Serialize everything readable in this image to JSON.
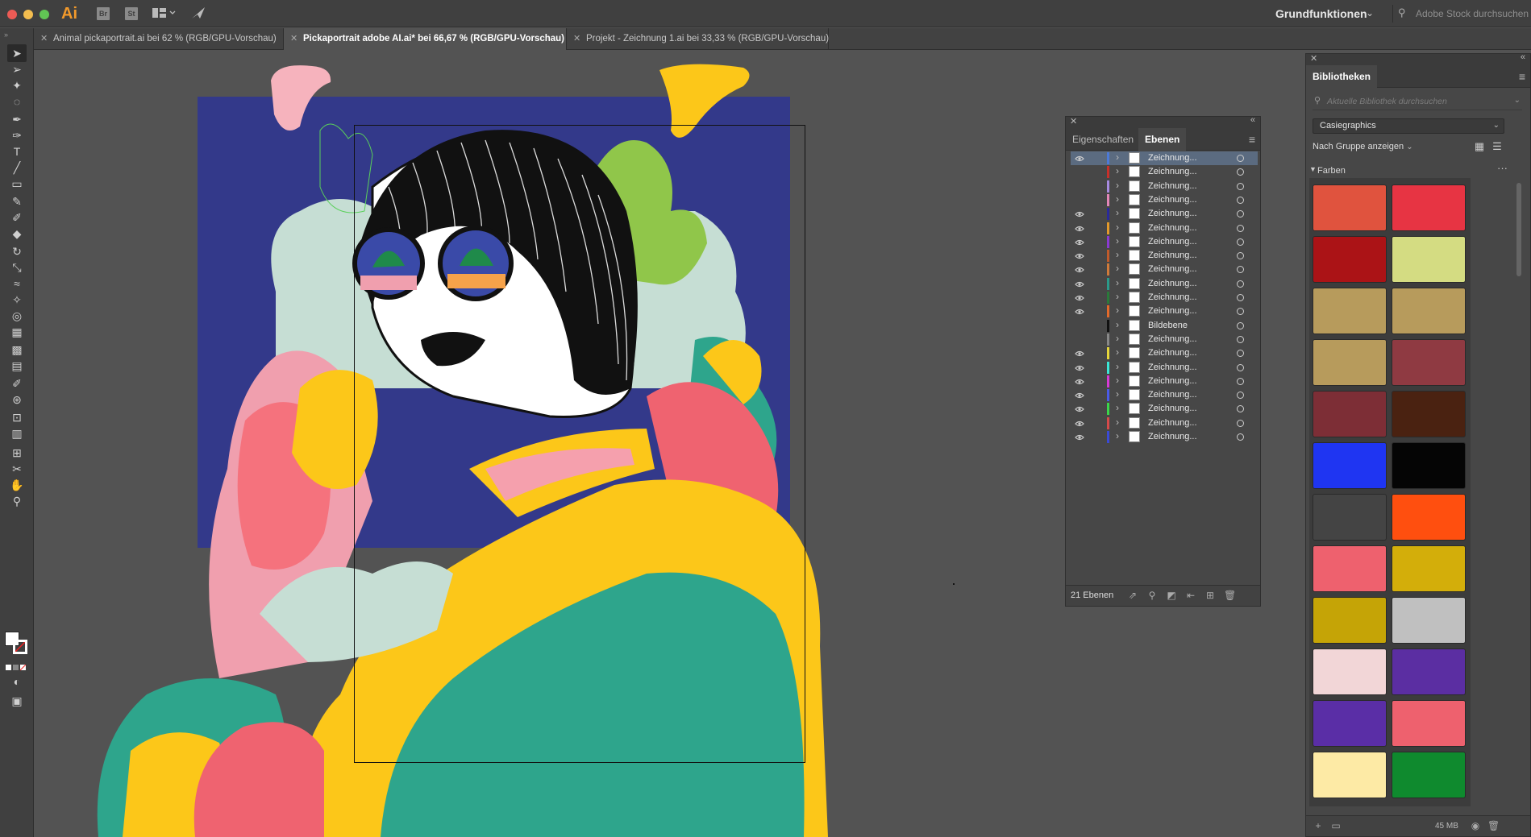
{
  "app": {
    "logo": "Ai",
    "bridge_label": "Br",
    "stock_label": "St",
    "workspace": "Grundfunktionen",
    "stock_search_placeholder": "Adobe Stock durchsuchen"
  },
  "tabs": [
    {
      "label": "Animal pickaportrait.ai bei 62 % (RGB/GPU-Vorschau)",
      "active": false
    },
    {
      "label": "Pickaportrait adobe AI.ai* bei 66,67 % (RGB/GPU-Vorschau)",
      "active": true
    },
    {
      "label": "Projekt - Zeichnung 1.ai bei 33,33 % (RGB/GPU-Vorschau)",
      "active": false
    }
  ],
  "tools": [
    {
      "name": "selection-tool-icon",
      "glyph": "➤"
    },
    {
      "name": "direct-selection-tool-icon",
      "glyph": "➢"
    },
    {
      "name": "magic-wand-tool-icon",
      "glyph": "✦"
    },
    {
      "name": "lasso-tool-icon",
      "glyph": "◌"
    },
    {
      "name": "pen-tool-icon",
      "glyph": "✒"
    },
    {
      "name": "curvature-tool-icon",
      "glyph": "✑"
    },
    {
      "name": "type-tool-icon",
      "glyph": "T"
    },
    {
      "name": "line-tool-icon",
      "glyph": "╱"
    },
    {
      "name": "rectangle-tool-icon",
      "glyph": "▭"
    },
    {
      "name": "paintbrush-tool-icon",
      "glyph": "✎"
    },
    {
      "name": "shaper-tool-icon",
      "glyph": "✐"
    },
    {
      "name": "eraser-tool-icon",
      "glyph": "◆"
    },
    {
      "name": "rotate-tool-icon",
      "glyph": "↻"
    },
    {
      "name": "scale-tool-icon",
      "glyph": "⤡"
    },
    {
      "name": "warp-tool-icon",
      "glyph": "≈"
    },
    {
      "name": "puppet-warp-tool-icon",
      "glyph": "✧"
    },
    {
      "name": "shape-builder-tool-icon",
      "glyph": "◎"
    },
    {
      "name": "perspective-grid-tool-icon",
      "glyph": "▦"
    },
    {
      "name": "mesh-tool-icon",
      "glyph": "▩"
    },
    {
      "name": "gradient-tool-icon",
      "glyph": "▤"
    },
    {
      "name": "eyedropper-tool-icon",
      "glyph": "✐"
    },
    {
      "name": "blend-tool-icon",
      "glyph": "⊛"
    },
    {
      "name": "symbol-sprayer-tool-icon",
      "glyph": "⊡"
    },
    {
      "name": "graph-tool-icon",
      "glyph": "▥"
    },
    {
      "name": "artboard-tool-icon",
      "glyph": "⊞"
    },
    {
      "name": "slice-tool-icon",
      "glyph": "✂"
    },
    {
      "name": "hand-tool-icon",
      "glyph": "✋"
    },
    {
      "name": "zoom-tool-icon",
      "glyph": "⚲"
    }
  ],
  "layers_panel": {
    "tab_properties": "Eigenschaften",
    "tab_layers": "Ebenen",
    "count_label": "21 Ebenen",
    "layers": [
      {
        "name": "Zeichnung...",
        "color": "#4c7ad8",
        "visible": true,
        "selected": true
      },
      {
        "name": "Zeichnung...",
        "color": "#c8302a",
        "visible": false,
        "selected": false
      },
      {
        "name": "Zeichnung...",
        "color": "#a78ae0",
        "visible": false,
        "selected": false
      },
      {
        "name": "Zeichnung...",
        "color": "#e386b8",
        "visible": false,
        "selected": false
      },
      {
        "name": "Zeichnung...",
        "color": "#2a2a9a",
        "visible": true,
        "selected": false
      },
      {
        "name": "Zeichnung...",
        "color": "#e39a2a",
        "visible": true,
        "selected": false
      },
      {
        "name": "Zeichnung...",
        "color": "#8a3ad0",
        "visible": true,
        "selected": false
      },
      {
        "name": "Zeichnung...",
        "color": "#c05a2a",
        "visible": true,
        "selected": false
      },
      {
        "name": "Zeichnung...",
        "color": "#d07a3a",
        "visible": true,
        "selected": false
      },
      {
        "name": "Zeichnung...",
        "color": "#2a9a8a",
        "visible": true,
        "selected": false
      },
      {
        "name": "Zeichnung...",
        "color": "#2a7a3a",
        "visible": true,
        "selected": false
      },
      {
        "name": "Zeichnung...",
        "color": "#e36a2a",
        "visible": true,
        "selected": false
      },
      {
        "name": "Bildebene",
        "color": "#111111",
        "visible": false,
        "selected": false
      },
      {
        "name": "Zeichnung...",
        "color": "#888888",
        "visible": false,
        "selected": false
      },
      {
        "name": "Zeichnung...",
        "color": "#e6d63a",
        "visible": true,
        "selected": false
      },
      {
        "name": "Zeichnung...",
        "color": "#3ae6d6",
        "visible": true,
        "selected": false
      },
      {
        "name": "Zeichnung...",
        "color": "#d63ad6",
        "visible": true,
        "selected": false
      },
      {
        "name": "Zeichnung...",
        "color": "#4a5ae6",
        "visible": true,
        "selected": false
      },
      {
        "name": "Zeichnung...",
        "color": "#3ad64a",
        "visible": true,
        "selected": false
      },
      {
        "name": "Zeichnung...",
        "color": "#d64a4a",
        "visible": true,
        "selected": false
      },
      {
        "name": "Zeichnung...",
        "color": "#3a4ad6",
        "visible": true,
        "selected": false
      }
    ]
  },
  "libraries_panel": {
    "title": "Bibliotheken",
    "search_placeholder": "Aktuelle Bibliothek durchsuchen",
    "library": "Casiegraphics",
    "group_by": "Nach Gruppe anzeigen",
    "section": "Farben",
    "storage": "45 MB",
    "swatches": [
      "#e0533e",
      "#e73443",
      "#ab1316",
      "#d4dc82",
      "#b79b5c",
      "#b79b5c",
      "#b79b5c",
      "#8f3a42",
      "#7d2e36",
      "#4a2211",
      "#1f35f2",
      "#050505",
      "#444444",
      "#ff4f0f",
      "#ee616e",
      "#d3ae0a",
      "#c5a406",
      "#c0c0c0",
      "#f2d6d7",
      "#5b2ea2",
      "#5a2ea6",
      "#ee616e",
      "#fdeaa5",
      "#0f8a2e"
    ]
  }
}
